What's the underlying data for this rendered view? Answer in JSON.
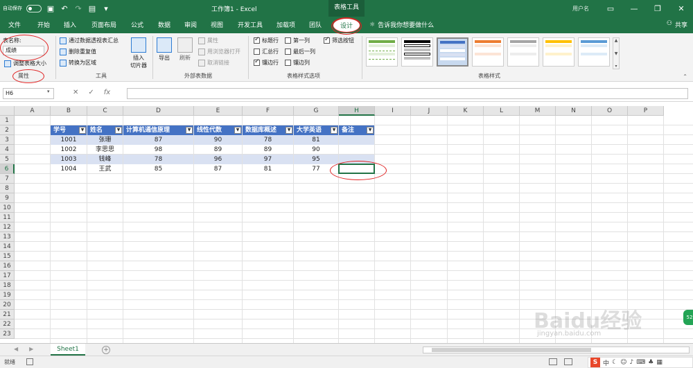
{
  "titlebar": {
    "autosave_label": "自动保存",
    "autosave_state": "关",
    "title": "工作簿1 - Excel",
    "context_title": "表格工具",
    "user": "用户名"
  },
  "tabs": [
    "文件",
    "开始",
    "插入",
    "页面布局",
    "公式",
    "数据",
    "审阅",
    "视图",
    "开发工具",
    "加载项",
    "团队",
    "设计"
  ],
  "active_tab": "设计",
  "tell_me": "告诉我你想要做什么",
  "share": "共享",
  "ribbon": {
    "properties": {
      "table_name_label": "表名称:",
      "table_name_value": "成绩",
      "resize": "调整表格大小",
      "group": "属性"
    },
    "tools": {
      "pivot": "通过数据透视表汇总",
      "dedupe": "删除重复值",
      "convert": "转换为区域",
      "slicer": "插入\n切片器",
      "group": "工具"
    },
    "external": {
      "export": "导出",
      "refresh": "刷新",
      "props": "属性",
      "browser": "用浏览器打开",
      "unlink": "取消链接",
      "group": "外部表数据"
    },
    "style_options": {
      "header_row": "标题行",
      "total_row": "汇总行",
      "banded_rows": "镶边行",
      "first_col": "第一列",
      "last_col": "最后一列",
      "banded_cols": "镶边列",
      "filter_btn": "筛选按钮",
      "group": "表格样式选项"
    },
    "styles_group": "表格样式"
  },
  "formula": {
    "namebox": "H6",
    "fx": "fx",
    "value": ""
  },
  "columns": [
    "A",
    "B",
    "C",
    "D",
    "E",
    "F",
    "G",
    "H",
    "I",
    "J",
    "K",
    "L",
    "M",
    "N",
    "O",
    "P"
  ],
  "rows": [
    "1",
    "2",
    "3",
    "4",
    "5",
    "6",
    "7",
    "8",
    "9",
    "10",
    "11",
    "12",
    "13",
    "14",
    "15",
    "16",
    "17",
    "18",
    "19",
    "20",
    "21",
    "22",
    "23"
  ],
  "table": {
    "headers": [
      "学号",
      "姓名",
      "计算机通信原理",
      "线性代数",
      "数据库概述",
      "大学英语",
      "备注"
    ],
    "rows": [
      [
        "1001",
        "张珊",
        "87",
        "90",
        "78",
        "81",
        ""
      ],
      [
        "1002",
        "李思思",
        "98",
        "89",
        "89",
        "90",
        ""
      ],
      [
        "1003",
        "钱峰",
        "78",
        "96",
        "97",
        "95",
        ""
      ],
      [
        "1004",
        "王武",
        "85",
        "87",
        "81",
        "77",
        ""
      ]
    ]
  },
  "sheet_tab": "Sheet1",
  "status": "就绪",
  "ime": {
    "logo": "S",
    "lang": "中"
  },
  "watermark": "Baidu经验",
  "watermark_sub": "jingyan.baidu.com",
  "zoom_badge": "52"
}
